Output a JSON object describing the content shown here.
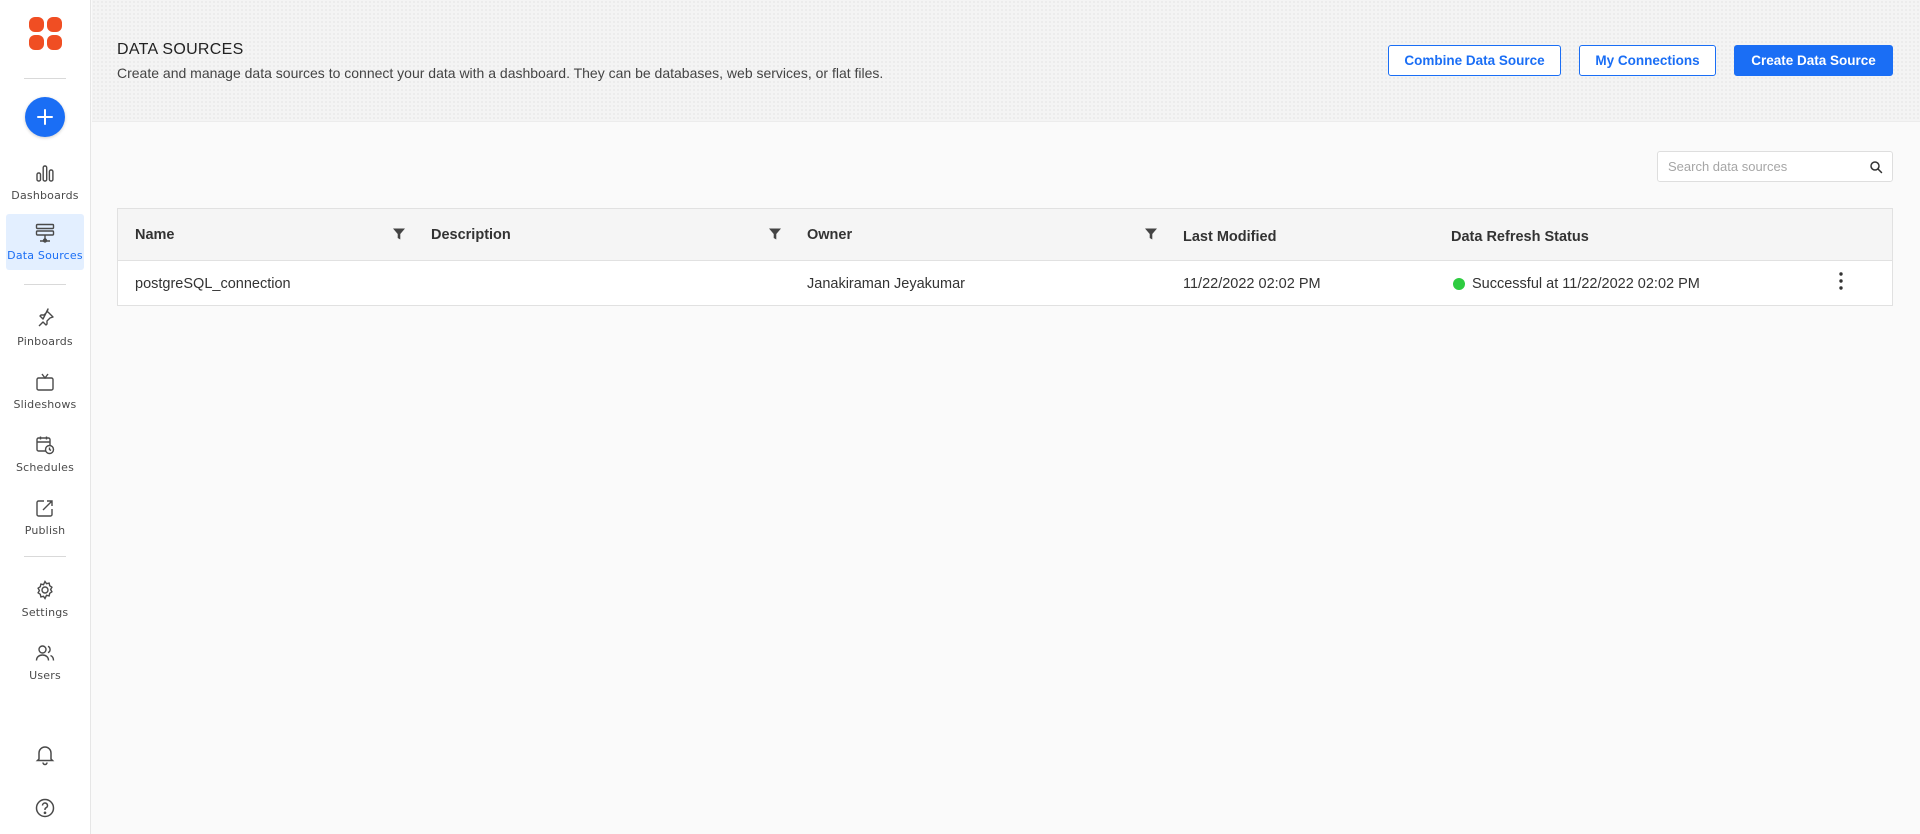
{
  "sidebar": {
    "items": [
      {
        "label": "Dashboards",
        "icon": "bar-chart-icon"
      },
      {
        "label": "Data Sources",
        "icon": "database-icon",
        "active": true
      },
      {
        "label": "Pinboards",
        "icon": "pin-icon"
      },
      {
        "label": "Slideshows",
        "icon": "tv-icon"
      },
      {
        "label": "Schedules",
        "icon": "calendar-clock-icon"
      },
      {
        "label": "Publish",
        "icon": "publish-icon"
      },
      {
        "label": "Settings",
        "icon": "gear-icon"
      },
      {
        "label": "Users",
        "icon": "users-icon"
      }
    ]
  },
  "header": {
    "title": "DATA SOURCES",
    "subtitle": "Create and manage data sources to connect your data with a dashboard. They can be databases, web services, or flat files.",
    "buttons": {
      "combine": "Combine Data Source",
      "connections": "My Connections",
      "create": "Create Data Source"
    }
  },
  "search": {
    "placeholder": "Search data sources"
  },
  "table": {
    "columns": [
      "Name",
      "Description",
      "Owner",
      "Last Modified",
      "Data Refresh Status"
    ],
    "rows": [
      {
        "name": "postgreSQL_connection",
        "description": "",
        "owner": "Janakiraman Jeyakumar",
        "last_modified": "11/22/2022 02:02 PM",
        "status": "Successful at 11/22/2022 02:02 PM"
      }
    ]
  },
  "colors": {
    "accent": "#1a6ef5",
    "logo": "#f04e23",
    "success": "#2ecc40"
  }
}
